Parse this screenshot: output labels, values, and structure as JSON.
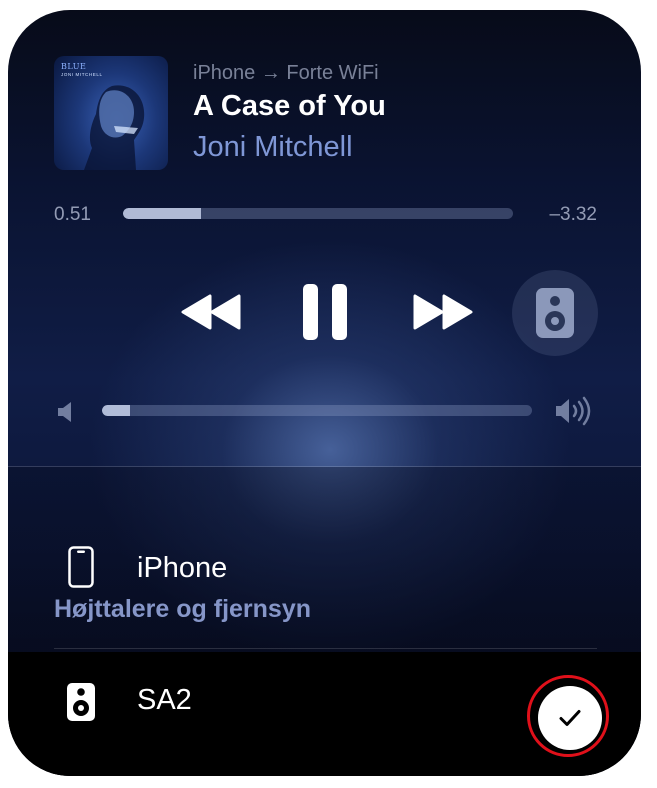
{
  "now_playing": {
    "route": "iPhone → Forte WiFi",
    "title": "A Case of You",
    "artist": "Joni Mitchell",
    "album_art": {
      "art_title": "BLUE",
      "art_artist": "JONI MITCHELL"
    }
  },
  "progress": {
    "elapsed": "0.51",
    "remaining": "–3.32",
    "fraction": 0.2
  },
  "controls": {
    "rewind_icon": "rewind-icon",
    "pause_icon": "pause-icon",
    "forward_icon": "fast-forward-icon",
    "output_icon": "speaker-icon"
  },
  "volume": {
    "fraction": 0.065,
    "min_icon": "speaker-low-icon",
    "max_icon": "speaker-high-icon"
  },
  "devices": {
    "iphone": {
      "name": "iPhone",
      "icon": "iphone-icon"
    },
    "section_header": "Højttalere og fjernsyn",
    "sa2": {
      "name": "SA2",
      "icon": "speaker-icon",
      "selected": true
    }
  },
  "colors": {
    "accent_artist": "#7f97d6",
    "selection_ring": "#e0101a"
  }
}
